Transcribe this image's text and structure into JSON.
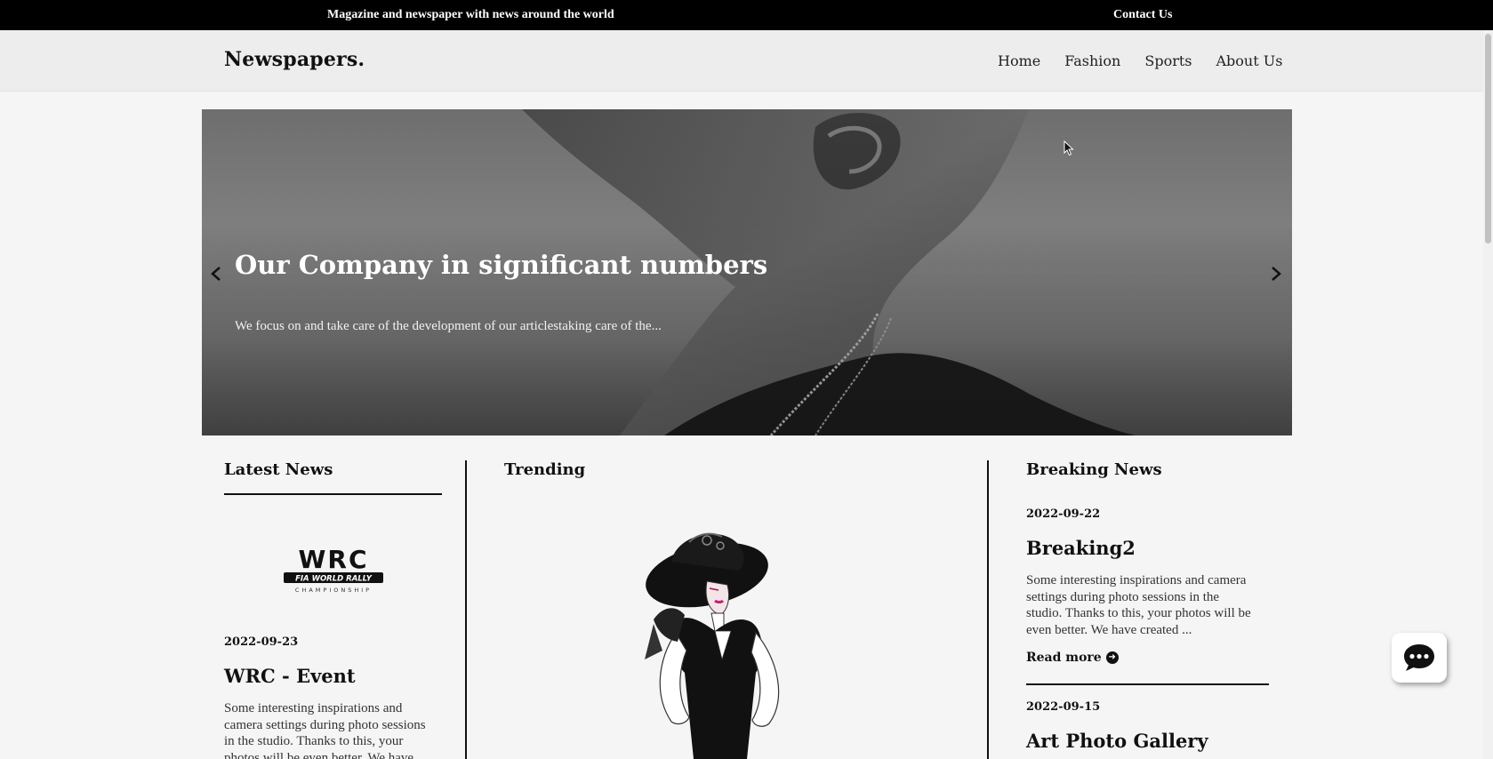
{
  "topbar": {
    "tagline": "Magazine and newspaper with news around the world",
    "contact": "Contact Us"
  },
  "header": {
    "logo": "Newspapers.",
    "nav": [
      "Home",
      "Fashion",
      "Sports",
      "About Us"
    ]
  },
  "hero": {
    "title": "Our Company in significant numbers",
    "subtitle": "We focus on and take care of the development of our articlestaking care of the...",
    "prev_icon": "chevron-left-icon",
    "next_icon": "chevron-right-icon"
  },
  "latest": {
    "heading": "Latest News",
    "logo_text": "WRC",
    "logo_line1": "FIA WORLD RALLY",
    "logo_line2": "CHAMPIONSHIP",
    "date": "2022-09-23",
    "title": "WRC - Event",
    "excerpt_lines": [
      "Some interesting inspirations and",
      "camera settings during photo sessions",
      "in the studio. Thanks to this, your",
      "photos will be even better. We have"
    ]
  },
  "trending": {
    "heading": "Trending"
  },
  "breaking": {
    "heading": "Breaking News",
    "items": [
      {
        "date": "2022-09-22",
        "title": "Breaking2",
        "excerpt_lines": [
          "Some interesting inspirations and camera",
          "settings during photo sessions in the",
          "studio. Thanks to this, your photos will be",
          "even better. We have created ..."
        ],
        "read_more": "Read more"
      },
      {
        "date": "2022-09-15",
        "title": "Art Photo Gallery"
      }
    ]
  },
  "chat": {
    "icon": "chat-bubble-icon"
  }
}
